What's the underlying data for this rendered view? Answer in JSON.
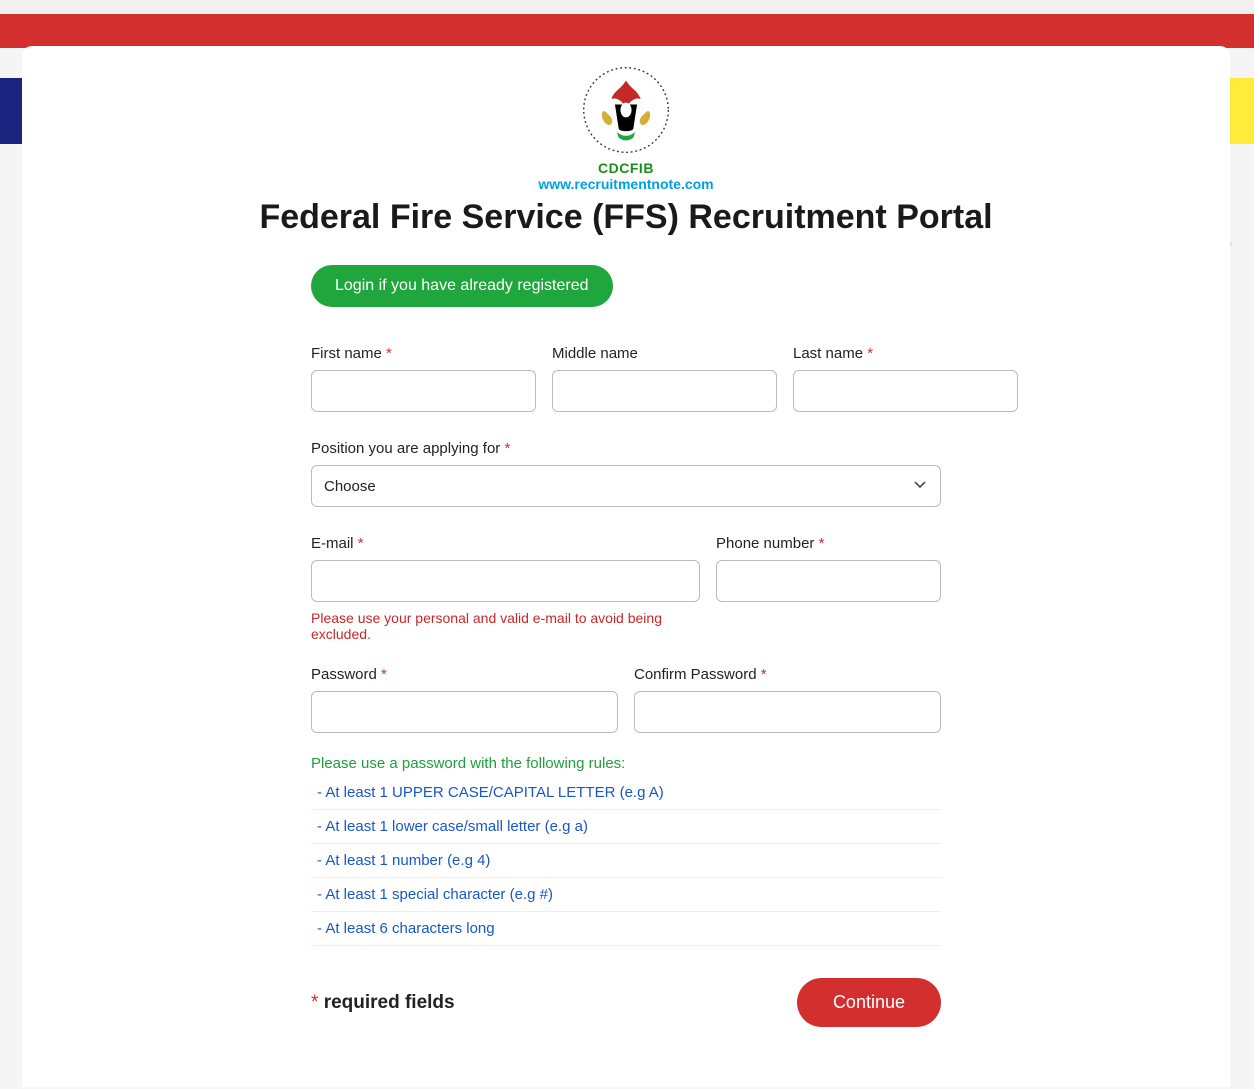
{
  "header": {
    "cdcfib": "CDCFIB",
    "url": "www.recruitmentnote.com",
    "title": "Federal Fire Service (FFS) Recruitment Portal"
  },
  "buttons": {
    "login": "Login if you have already registered",
    "continue": "Continue"
  },
  "labels": {
    "first_name": "First name",
    "middle_name": "Middle name",
    "last_name": "Last name",
    "position": "Position you are applying for",
    "position_placeholder": "Choose",
    "email": "E-mail",
    "phone": "Phone number",
    "password": "Password",
    "confirm_password": "Confirm Password"
  },
  "messages": {
    "email_warning": "Please use your personal and valid e-mail to avoid being excluded.",
    "password_intro": "Please use a password with the following rules:",
    "required_fields": "required fields"
  },
  "password_rules": {
    "r0": " - At least 1 UPPER CASE/CAPITAL LETTER (e.g A)",
    "r1": " - At least 1 lower case/small letter (e.g a)",
    "r2": " - At least 1 number (e.g 4)",
    "r3": " - At least 1 special character (e.g #)",
    "r4": " - At least 6 characters long"
  },
  "star": "*"
}
